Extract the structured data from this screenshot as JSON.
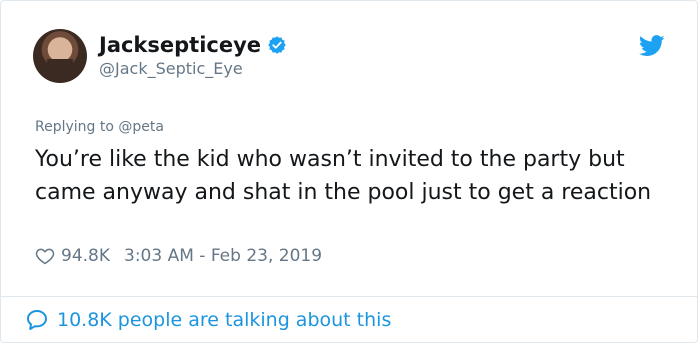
{
  "tweet": {
    "author": {
      "display_name": "Jacksepticeye",
      "handle": "@Jack_Septic_Eye",
      "verified": true
    },
    "replying_prefix": "Replying to",
    "replying_to": "@peta",
    "text": "You’re like the kid who wasn’t invited to the party but came anyway and shat in the pool just to get a reaction",
    "likes": "94.8K",
    "timestamp": "3:03 AM - Feb 23, 2019",
    "footer_text": "10.8K people are talking about this"
  },
  "icons": {
    "verified": "verified-badge-icon",
    "bird": "twitter-bird-icon",
    "heart": "heart-icon",
    "bubble": "comment-bubble-icon"
  },
  "colors": {
    "brand_blue": "#1da1f2",
    "link_blue": "#1b95e0",
    "muted_gray": "#657786",
    "text": "#14171a",
    "border": "#e1e8ed"
  }
}
